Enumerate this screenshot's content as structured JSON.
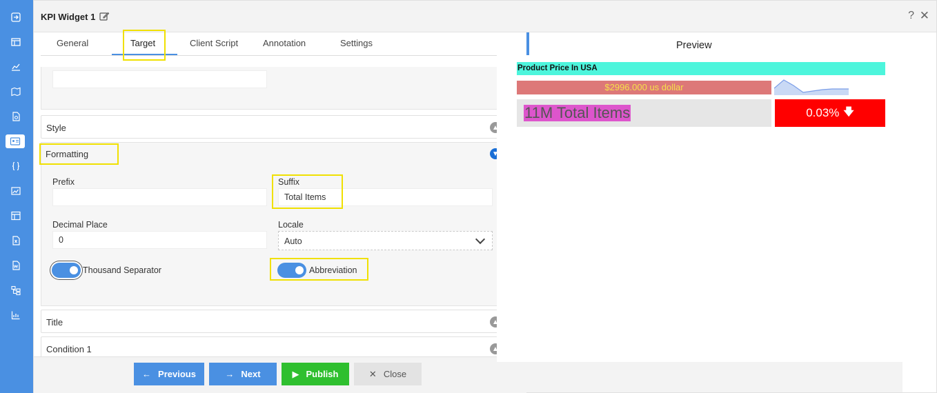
{
  "window": {
    "title": "KPI Widget 1",
    "help": "?",
    "close": "✕"
  },
  "tabs": [
    {
      "label": "General"
    },
    {
      "label": "Target"
    },
    {
      "label": "Client Script"
    },
    {
      "label": "Annotation"
    },
    {
      "label": "Settings"
    }
  ],
  "sections": {
    "style": "Style",
    "formatting": "Formatting",
    "title": "Title",
    "condition": "Condition 1"
  },
  "formatting": {
    "prefix_label": "Prefix",
    "prefix_value": "",
    "suffix_label": "Suffix",
    "suffix_value": "Total Items",
    "decimal_label": "Decimal Place",
    "decimal_value": "0",
    "locale_label": "Locale",
    "locale_value": "Auto",
    "thousand_separator_label": "Thousand Separator",
    "thousand_separator_on": true,
    "abbreviation_label": "Abbreviation",
    "abbreviation_on": true
  },
  "buttons": {
    "previous": "Previous",
    "next": "Next",
    "publish": "Publish",
    "close": "Close"
  },
  "preview": {
    "heading": "Preview",
    "kpi_name": "Product Price In USA",
    "kpi_secondary": "$2996.000 us dollar",
    "kpi_value": "11M Total Items",
    "kpi_delta": "0.03%",
    "delta_direction": "down"
  },
  "colors": {
    "accent": "#4a90e2",
    "highlight": "#f0e000",
    "kpi_name_bg": "#4df5dc",
    "kpi_secondary_bg": "#dd7878",
    "kpi_value_highlight": "#dd55cc",
    "kpi_delta_bg": "#ff0000",
    "publish": "#2fbf2f"
  },
  "rail_icons": [
    "enter-icon",
    "table-icon",
    "analytics-icon",
    "map-icon",
    "document-icon",
    "id-card-icon",
    "code-braces-icon",
    "image-chart-icon",
    "layout-icon",
    "excel-icon",
    "word-icon",
    "hierarchy-icon",
    "chart-icon"
  ]
}
